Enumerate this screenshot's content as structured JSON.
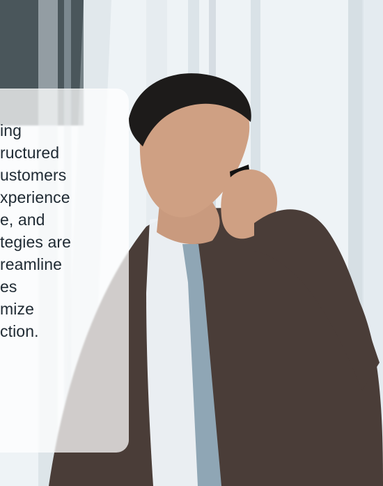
{
  "callout": {
    "lines": [
      "ing",
      "ructured",
      "ustomers",
      "xperience",
      "e, and",
      "tegies are",
      "reamline",
      "es",
      "mize",
      "ction."
    ]
  },
  "hero": {
    "subject_icon": "businessman-on-phone",
    "background_icon": "office-window"
  },
  "colors": {
    "text": "#1f2a33",
    "card_bg": "rgba(255,255,255,0.74)",
    "suit": "#4a3d38",
    "tie": "#8fa6b5",
    "shirt": "#eef2f6"
  }
}
